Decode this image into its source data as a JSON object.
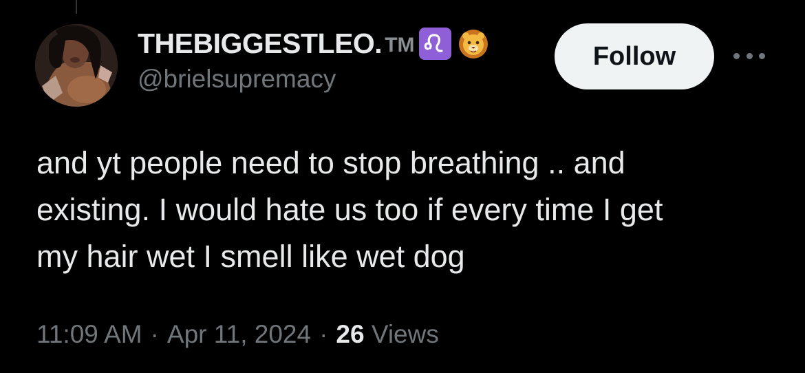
{
  "tweet": {
    "author": {
      "display_name": "THEBIGGESTLEO.",
      "tm_suffix": "TM",
      "zodiac_emoji": "♌",
      "animal_emoji": "lion-face",
      "handle": "@brielsupremacy",
      "avatar": "user-avatar-photo"
    },
    "follow_label": "Follow",
    "more_icon": "more-horizontal-icon",
    "text_lines": [
      "and yt people need to stop breathing .. and",
      "existing. I would hate us too if every time I get",
      "my hair wet I smell like wet dog"
    ],
    "time": "11:09 AM",
    "separator": "·",
    "date": "Apr 11, 2024",
    "views_count": "26",
    "views_label": "Views"
  },
  "colors": {
    "background": "#000000",
    "primary_text": "#e7e9ea",
    "secondary_text": "#71767b",
    "follow_bg": "#eff3f4",
    "leo_badge": "#8e5fd6"
  }
}
